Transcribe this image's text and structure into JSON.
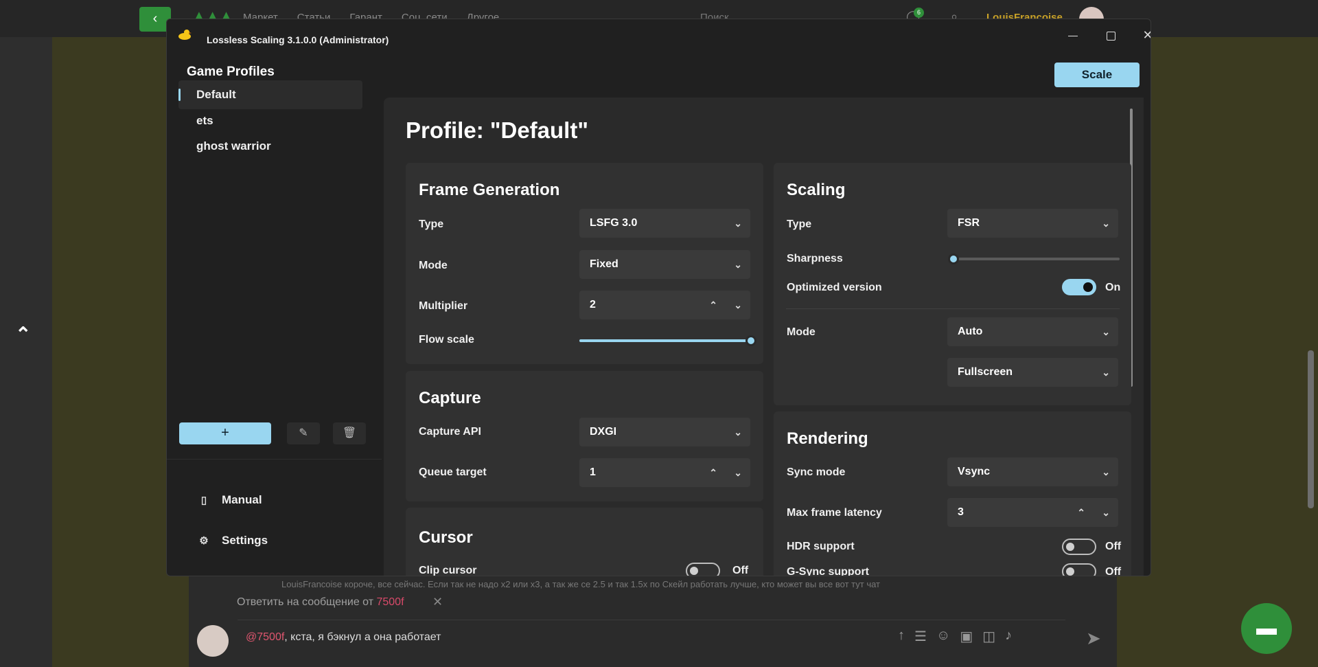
{
  "browser": {
    "nav": [
      "Маркет",
      "Статьи",
      "Гарант",
      "Соц. сети",
      "Другое"
    ],
    "search_placeholder": "Поиск",
    "notifications_count": "6",
    "user_name": "LouisFrancoise",
    "reply_prefix": "Ответить на сообщение от",
    "reply_nick": "7500f",
    "blur_line": "LouisFrancoise  короче, все сейчас. Если так не надо х2 или х3, а так же се 2.5 и так 1.5х по Скейл работать лучше, кто может вы все вот тут чат",
    "chat_mention": "@7500f",
    "chat_text": ", кста, я бэкнул а она работает"
  },
  "window": {
    "title": "Lossless Scaling 3.1.0.0 (Administrator)",
    "header": "Game Profiles",
    "scale_button": "Scale",
    "profiles": [
      "Default",
      "ets",
      "ghost warrior"
    ],
    "add_label": "+",
    "nav": {
      "manual": "Manual",
      "settings": "Settings"
    },
    "profile_title": "Profile: \"Default\""
  },
  "frame_generation": {
    "title": "Frame Generation",
    "type_label": "Type",
    "type_value": "LSFG 3.0",
    "mode_label": "Mode",
    "mode_value": "Fixed",
    "multiplier_label": "Multiplier",
    "multiplier_value": "2",
    "flow_scale_label": "Flow scale",
    "flow_scale_level": 1.0
  },
  "capture": {
    "title": "Capture",
    "api_label": "Capture API",
    "api_value": "DXGI",
    "queue_label": "Queue target",
    "queue_value": "1"
  },
  "cursor": {
    "title": "Cursor",
    "clip_label": "Clip cursor",
    "clip_state": "Off"
  },
  "scaling": {
    "title": "Scaling",
    "type_label": "Type",
    "type_value": "FSR",
    "sharpness_label": "Sharpness",
    "sharpness_level": 0.0,
    "optimized_label": "Optimized version",
    "optimized_state": "On",
    "mode_label": "Mode",
    "mode_value": "Auto",
    "mode2_value": "Fullscreen"
  },
  "rendering": {
    "title": "Rendering",
    "sync_label": "Sync mode",
    "sync_value": "Vsync",
    "latency_label": "Max frame latency",
    "latency_value": "3",
    "hdr_label": "HDR support",
    "hdr_state": "Off",
    "gsync_label": "G-Sync support",
    "gsync_state": "Off"
  },
  "colors": {
    "accent": "#99d6f0",
    "background": "#202020",
    "card": "#313131"
  }
}
